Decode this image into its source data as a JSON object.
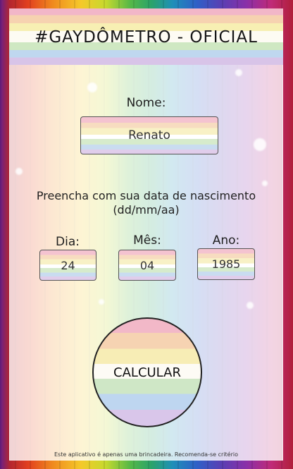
{
  "header": {
    "title": "#GAYDÔMETRO - OFICIAL"
  },
  "form": {
    "name_label": "Nome:",
    "name_value": "Renato",
    "instruction_line1": "Preencha com sua data de nascimento",
    "instruction_line2": "(dd/mm/aa)",
    "day_label": "Dia:",
    "day_value": "24",
    "month_label": "Mês:",
    "month_value": "04",
    "year_label": "Ano:",
    "year_value": "1985"
  },
  "actions": {
    "calculate_label": "CALCULAR"
  },
  "footer": {
    "disclaimer": "Este aplicativo é apenas uma brincadeira. Recomenda-se critério"
  },
  "colors": {
    "text": "#1e1e1e",
    "border": "#555555"
  }
}
